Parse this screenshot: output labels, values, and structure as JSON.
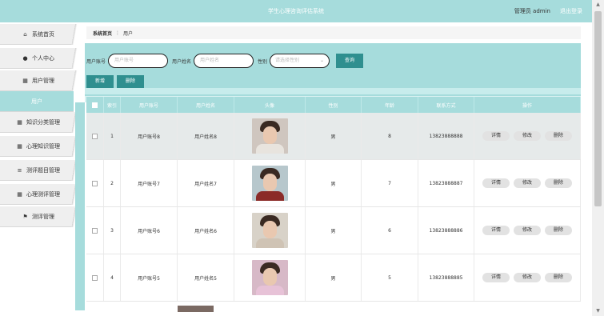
{
  "header": {
    "title": "学生心理咨询评估系统",
    "admin_label": "管理员 admin",
    "logout_label": "退出登录"
  },
  "sidebar": {
    "items": [
      {
        "label": "系统首页",
        "icon": "home-icon",
        "glyph": "⌂",
        "active": false
      },
      {
        "label": "个人中心",
        "icon": "user-icon",
        "glyph": "●",
        "active": false
      },
      {
        "label": "用户管理",
        "icon": "grid-icon",
        "glyph": "▦",
        "active": false
      },
      {
        "label": "用户",
        "icon": "",
        "glyph": "",
        "active": true
      },
      {
        "label": "知识分类管理",
        "icon": "grid-icon",
        "glyph": "▦",
        "active": false
      },
      {
        "label": "心理知识管理",
        "icon": "grid-icon",
        "glyph": "▦",
        "active": false
      },
      {
        "label": "测评题目管理",
        "icon": "list-icon",
        "glyph": "≡",
        "active": false
      },
      {
        "label": "心理测评管理",
        "icon": "grid-icon",
        "glyph": "▦",
        "active": false
      },
      {
        "label": "测评管理",
        "icon": "flag-icon",
        "glyph": "⚑",
        "active": false
      }
    ]
  },
  "breadcrumb": {
    "home": "系统首页",
    "current": "用户"
  },
  "search": {
    "account_label": "用户账号",
    "account_placeholder": "用户账号",
    "name_label": "用户姓名",
    "name_placeholder": "用户姓名",
    "sex_label": "性别",
    "sex_placeholder": "请选择性别",
    "query_label": "查询"
  },
  "actions": {
    "add_label": "新增",
    "delete_label": "删除"
  },
  "table": {
    "headers": [
      "索引",
      "用户账号",
      "用户姓名",
      "头像",
      "性别",
      "年龄",
      "联系方式",
      "操作"
    ],
    "rows": [
      {
        "index": "1",
        "account": "用户账号8",
        "name": "用户姓名8",
        "sex": "男",
        "age": "8",
        "phone": "13823888888",
        "avatar_bg": "#cfc6bf",
        "avatar_body": "#e8e4de"
      },
      {
        "index": "2",
        "account": "用户账号7",
        "name": "用户姓名7",
        "sex": "男",
        "age": "7",
        "phone": "13823888887",
        "avatar_bg": "#b7c7cc",
        "avatar_body": "#8b2b28"
      },
      {
        "index": "3",
        "account": "用户账号6",
        "name": "用户姓名6",
        "sex": "男",
        "age": "6",
        "phone": "13823888886",
        "avatar_bg": "#d8d2c8",
        "avatar_body": "#cfc3b4"
      },
      {
        "index": "4",
        "account": "用户账号5",
        "name": "用户姓名5",
        "sex": "男",
        "age": "5",
        "phone": "13823888885",
        "avatar_bg": "#d7b9c7",
        "avatar_body": "#e7c2d7"
      }
    ],
    "ops": {
      "detail": "详情",
      "edit": "修改",
      "delete": "删除"
    }
  },
  "colors": {
    "accent": "#a6dcdc",
    "button": "#2f8f8f"
  }
}
